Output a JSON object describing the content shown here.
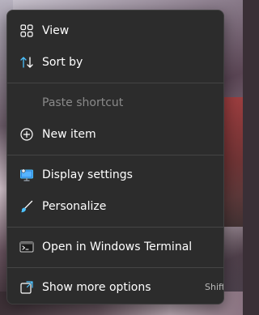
{
  "menu": {
    "items": [
      {
        "label": "View",
        "icon": "grid-icon"
      },
      {
        "label": "Sort by",
        "icon": "sort-arrows-icon"
      },
      {
        "label": "Paste shortcut",
        "icon": "none",
        "disabled": true
      },
      {
        "label": "New item",
        "icon": "plus-circle-icon"
      },
      {
        "label": "Display settings",
        "icon": "monitor-icon"
      },
      {
        "label": "Personalize",
        "icon": "brush-icon"
      },
      {
        "label": "Open in Windows Terminal",
        "icon": "terminal-icon"
      },
      {
        "label": "Show more options",
        "icon": "expand-icon",
        "shortcut": "Shift"
      }
    ]
  },
  "colors": {
    "menu_bg": "#2c2c2c",
    "text": "#ffffff",
    "disabled_text": "#8a8a8a",
    "accent_blue": "#4cc2ff",
    "separator": "#454545"
  }
}
